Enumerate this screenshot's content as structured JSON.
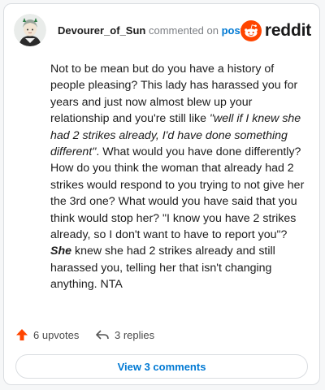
{
  "header": {
    "author": "Devourer_of_Sun",
    "action_text": " commented on ",
    "post_link": "post",
    "brand": "reddit"
  },
  "comment": {
    "p1": "Not to be mean but do you have a history of people pleasing? This lady has harassed you for years and just now almost blew up your relationship and you're still like ",
    "quote": "\"well if I knew she had 2 strikes already, I'd have done something different\"",
    "p2": ". What would you have done differently? How do you think the woman that already had 2 strikes would respond to you trying to not give her the 3rd one? What would you have said that you think would stop her? \"I know you have 2 strikes already, so I don't want to have to report you\"? ",
    "emphasis": "She",
    "p3": " knew she had 2 strikes already and still harassed you, telling her that isn't changing anything. NTA"
  },
  "footer": {
    "upvotes": "6 upvotes",
    "replies": "3 replies",
    "view_comments": "View 3 comments"
  },
  "colors": {
    "upvote": "#ff4500",
    "link": "#0079d3",
    "brand": "#ff4500"
  }
}
